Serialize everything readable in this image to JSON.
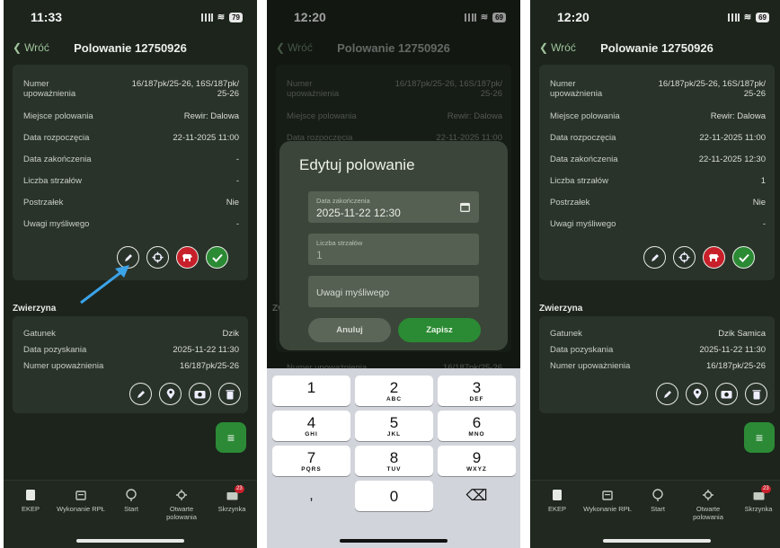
{
  "colors": {
    "background": "#1c241c",
    "card": "#2a332a",
    "accent_green": "#2b8a34",
    "accent_red": "#c8202b",
    "link": "#a0c49b"
  },
  "screens": [
    {
      "time": "11:33",
      "battery": "79",
      "back_label": "Wróć",
      "title": "Polowanie 12750926",
      "details": [
        {
          "label": "Numer upoważnienia",
          "value": "16/187pk/25-26, 16S/187pk/ 25-26"
        },
        {
          "label": "Miejsce polowania",
          "value": "Rewir: Dalowa"
        },
        {
          "label": "Data rozpoczęcia",
          "value": "22-11-2025 11:00"
        },
        {
          "label": "Data zakończenia",
          "value": "-"
        },
        {
          "label": "Liczba strzałów",
          "value": "-"
        },
        {
          "label": "Postrzałek",
          "value": "Nie"
        },
        {
          "label": "Uwagi myśliwego",
          "value": "-"
        }
      ],
      "section_title": "Zwierzyna",
      "game": [
        {
          "label": "Gatunek",
          "value": "Dzik"
        },
        {
          "label": "Data pozyskania",
          "value": "2025-11-22 11:30"
        },
        {
          "label": "Numer upoważnienia",
          "value": "16/187pk/25-26"
        }
      ]
    },
    {
      "time": "12:20",
      "battery": "69",
      "back_label": "Wróć",
      "title": "Polowanie 12750926",
      "bg_rows": [
        {
          "label": "Numer upoważnienia",
          "value": "16/187pk/25-26, 16S/187pk/ 25-26"
        },
        {
          "label": "Miejsce polowania",
          "value": "Rewir: Dalowa"
        },
        {
          "label": "Data rozpoczęcia",
          "value": "22-11-2025 11:00"
        }
      ],
      "bg_bottom_row": {
        "label": "Numer upoważnienia",
        "value": "16/187pk/25-26"
      },
      "bg_section_stub": "Zv",
      "modal": {
        "title": "Edytuj polowanie",
        "end_date_label": "Data zakończenia",
        "end_date_value": "2025-11-22 12:30",
        "shots_label": "Liczba strzałów",
        "shots_value": "1",
        "notes_placeholder": "Uwagi myśliwego",
        "cancel": "Anuluj",
        "save": "Zapisz"
      },
      "keyboard": [
        {
          "n": "1",
          "l": ""
        },
        {
          "n": "2",
          "l": "ABC"
        },
        {
          "n": "3",
          "l": "DEF"
        },
        {
          "n": "4",
          "l": "GHI"
        },
        {
          "n": "5",
          "l": "JKL"
        },
        {
          "n": "6",
          "l": "MNO"
        },
        {
          "n": "7",
          "l": "PQRS"
        },
        {
          "n": "8",
          "l": "TUV"
        },
        {
          "n": "9",
          "l": "WXYZ"
        },
        {
          "n": "0",
          "l": ""
        }
      ],
      "key_comma": ",",
      "key_delete": "⌫"
    },
    {
      "time": "12:20",
      "battery": "69",
      "back_label": "Wróć",
      "title": "Polowanie 12750926",
      "details": [
        {
          "label": "Numer upoważnienia",
          "value": "16/187pk/25-26, 16S/187pk/ 25-26"
        },
        {
          "label": "Miejsce polowania",
          "value": "Rewir: Dalowa"
        },
        {
          "label": "Data rozpoczęcia",
          "value": "22-11-2025 11:00"
        },
        {
          "label": "Data zakończenia",
          "value": "22-11-2025 12:30"
        },
        {
          "label": "Liczba strzałów",
          "value": "1"
        },
        {
          "label": "Postrzałek",
          "value": "Nie"
        },
        {
          "label": "Uwagi myśliwego",
          "value": "-"
        }
      ],
      "section_title": "Zwierzyna",
      "game": [
        {
          "label": "Gatunek",
          "value": "Dzik Samica"
        },
        {
          "label": "Data pozyskania",
          "value": "2025-11-22 11:30"
        },
        {
          "label": "Numer upoważnienia",
          "value": "16/187pk/25-26"
        }
      ]
    }
  ],
  "tabbar": [
    {
      "label": "EKEP",
      "icon": "ekep-icon"
    },
    {
      "label": "Wykonanie RPŁ",
      "icon": "calendar-icon"
    },
    {
      "label": "Start",
      "icon": "start-icon"
    },
    {
      "label": "Otwarte polowania",
      "icon": "crosshair-icon"
    },
    {
      "label": "Skrzynka",
      "icon": "inbox-icon"
    }
  ],
  "inbox_badge": "23"
}
